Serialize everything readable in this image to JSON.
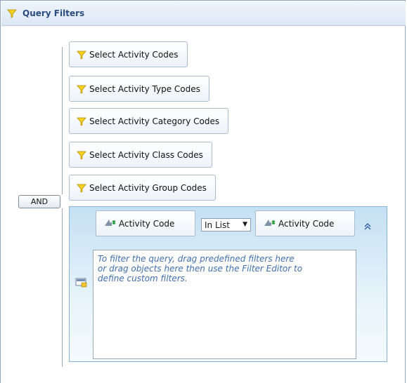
{
  "header": {
    "title": "Query Filters",
    "icon": "funnel-icon"
  },
  "logic": {
    "and_label": "AND"
  },
  "filters": [
    {
      "label": "Select Activity Codes"
    },
    {
      "label": "Select Activity Type Codes"
    },
    {
      "label": "Select Activity Category Codes"
    },
    {
      "label": "Select Activity Class Codes"
    },
    {
      "label": "Select Activity Group Codes"
    }
  ],
  "rule": {
    "left_field": "Activity Code",
    "operator": "In List",
    "right_field": "Activity Code",
    "hint": "To filter the query, drag predefined filters here or drag objects here then use the Filter Editor to define custom filters.",
    "hint_lines": [
      "To filter the query, drag predefined filters here",
      "or drag objects here then use the Filter Editor to",
      "define custom filters."
    ]
  },
  "colors": {
    "header_title": "#2b4c80",
    "hint_text": "#3f6fb0",
    "panel": "#c4e0f3"
  }
}
